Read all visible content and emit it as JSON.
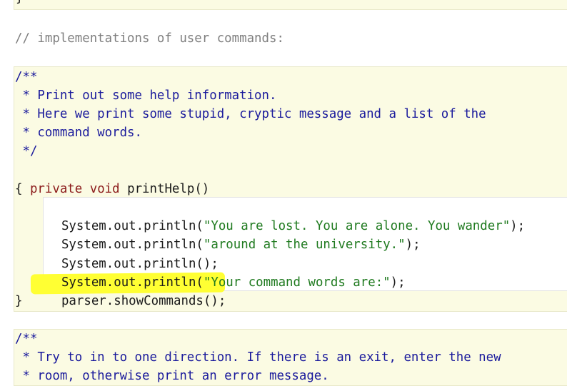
{
  "top_fragment": "}",
  "section_comment": "// implementations of user commands:",
  "method_javadoc": [
    "/**",
    " * Print out some help information.",
    " * Here we print some stupid, cryptic message and a list of the",
    " * command words.",
    " */"
  ],
  "signature": {
    "modifier": "private",
    "return_type": "void",
    "name": "printHelp()"
  },
  "open_brace": "{",
  "close_brace": "}",
  "body": [
    {
      "prefix": "System.out.println(",
      "string": "\"You are lost. You are alone. You wander\"",
      "suffix": ");"
    },
    {
      "prefix": "System.out.println(",
      "string": "\"around at the university.\"",
      "suffix": ");"
    },
    {
      "prefix": "System.out.println();",
      "string": "",
      "suffix": ""
    },
    {
      "prefix": "System.out.println(",
      "string": "\"Your command words are:\"",
      "suffix": ");"
    },
    {
      "prefix": "parser.showCommands();",
      "string": "",
      "suffix": ""
    }
  ],
  "highlighted_line_index": 4,
  "highlight_color": "#ffff33",
  "next_javadoc": [
    "/**",
    " * Try to in to one direction. If there is an exit, enter the new",
    " * room, otherwise print an error message."
  ],
  "colors": {
    "comment": "#7f7f7f",
    "javadoc": "#1a1a9c",
    "keyword": "#8b1a1a",
    "string": "#1f7a1f",
    "code": "#1a1a1a",
    "block_background": "#fbfbe3"
  }
}
